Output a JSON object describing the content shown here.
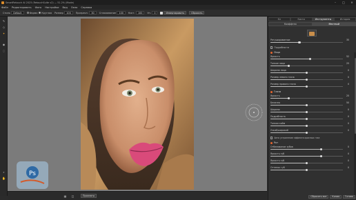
{
  "window": {
    "title": "SmartRetouch AI 2023 (RetouchSuite v2) — 51.2% (Mode)"
  },
  "menu": [
    "Файл",
    "Редактировать",
    "Фото",
    "Настройки",
    "Вид",
    "Окно",
    "Справка"
  ],
  "toolbar": {
    "style_label": "Стиль",
    "style_value": "Default",
    "shape_label": "Форма",
    "shape_value": "Круглая",
    "size_label": "Размер",
    "size_value": "100",
    "hardness_label": "Прозрачн.",
    "hardness_value": "30",
    "smooth_label": "Сглаживание",
    "smooth_value": "100",
    "opacity_label": "Кист.",
    "opacity_value": "100",
    "lev_label": "Уп.",
    "lev_value": "0",
    "invert_label": "Инвертировать",
    "reset_label": "Сбросить"
  },
  "statusbar": {
    "preview_label": "Просмотр"
  },
  "panel": {
    "tabs": [
      "Кл",
      "Кисти",
      "Инструменты",
      "История"
    ],
    "active_tab": 2,
    "subtabs": [
      "Коэффтея",
      "Местный"
    ],
    "active_subtab": 1,
    "rows": [
      {
        "label": "Ретушированное",
        "value": "35"
      },
      {
        "label": "Подробности",
        "value": "",
        "checkbox": true
      },
      {
        "label": "Лицо",
        "value": "",
        "section": true
      },
      {
        "label": "Яркость",
        "value": "52"
      },
      {
        "label": "Тонкое лицо",
        "value": "25"
      },
      {
        "label": "Ширина лица",
        "value": "0"
      },
      {
        "label": "Размер левого глаза",
        "value": "0"
      },
      {
        "label": "Размер правого глаза",
        "value": "0"
      },
      {
        "label": "Глаза",
        "value": "",
        "section": true
      },
      {
        "label": "Яркость",
        "value": "25"
      },
      {
        "label": "Белизна",
        "value": "50"
      },
      {
        "label": "Ширина",
        "value": "0"
      },
      {
        "label": "Подробность",
        "value": "0"
      },
      {
        "label": "Тонкая кайм",
        "value": "0"
      },
      {
        "label": "Узкий/широкий",
        "value": "0"
      },
      {
        "label": "Авто устранение эффекта красных глаз",
        "value": "",
        "checkbox": true
      },
      {
        "label": "Рот",
        "value": "",
        "section": true
      },
      {
        "label": "Отбеливание зубов",
        "value": "0"
      },
      {
        "label": "Яркость губ",
        "value": "0"
      },
      {
        "label": "Яркость губ",
        "value": "0"
      },
      {
        "label": "Оттенок губ",
        "value": "0"
      }
    ],
    "buttons": [
      "Сбросить все",
      "Копия",
      "Готово"
    ],
    "levels": [
      0.4,
      null,
      null,
      0.55,
      0.25,
      0.5,
      0.5,
      0.5,
      null,
      0.25,
      0.5,
      0.5,
      0.5,
      0.5,
      0.5,
      null,
      null,
      0.7,
      0.7,
      0.5,
      0.5
    ]
  },
  "colors": {
    "accent": "#e6662e",
    "canvas_bg": "#7b7b7b",
    "lip": "#d94a7a"
  },
  "icons": {
    "watermark": "photoshop-badge-icon",
    "cursor": "brush-circle-icon"
  }
}
